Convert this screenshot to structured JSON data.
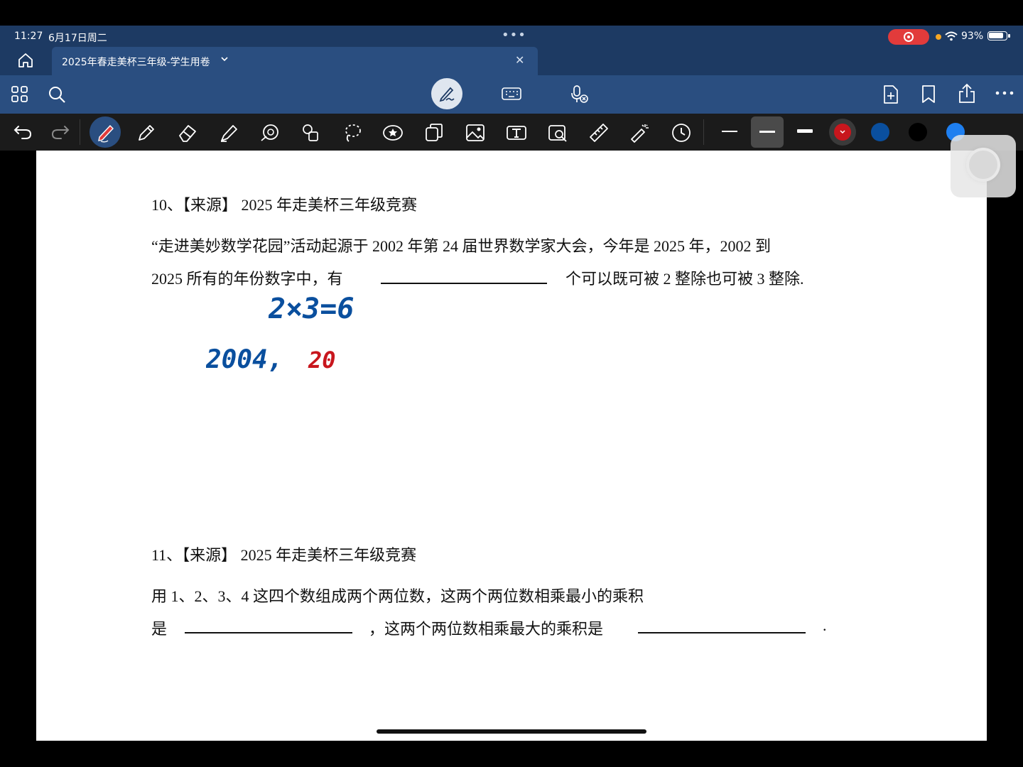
{
  "status": {
    "time": "11:27",
    "date": "6月17日周二",
    "battery": "93%",
    "battery_level": 0.93
  },
  "tab": {
    "title": "2025年春走美杯三年级-学生用卷"
  },
  "toolbar": {
    "top_icons": [
      "grid-icon",
      "search-icon",
      "handwriting-icon",
      "keyboard-icon",
      "voice-icon",
      "add-page-icon",
      "bookmark-icon",
      "share-icon",
      "more-icon"
    ],
    "tools": [
      "undo-icon",
      "redo-icon",
      "pen-icon",
      "pencil-icon",
      "eraser-icon",
      "highlighter-icon",
      "shape-icon",
      "element-icon",
      "lasso-icon",
      "sticker-icon",
      "copy-icon",
      "image-icon",
      "text-box-icon",
      "camera-icon",
      "ruler-icon",
      "laser-pointer-icon",
      "history-icon"
    ],
    "colors": [
      "#c8161d",
      "#0a4f9e",
      "#000000",
      "#1e7ff0"
    ]
  },
  "document": {
    "q10": {
      "header": "10、【来源】 2025 年走美杯三年级竞赛",
      "line1": "“走进美妙数学花园”活动起源于 2002 年第 24 届世界数学家大会，今年是 2025 年，2002 到",
      "line2a": "2025 所有的年份数字中，有",
      "line2b": "个可以既可被 2 整除也可被 3 整除."
    },
    "q11": {
      "header": "11、【来源】 2025 年走美杯三年级竞赛",
      "line1": "用 1、2、3、4 这四个数组成两个两位数，这两个两位数相乘最小的乘积",
      "line2a": "是",
      "line2b": "，这两个两位数相乘最大的乘积是",
      "line2c": "."
    },
    "handwriting": {
      "line1": "2×3=6",
      "line2a": "2004,",
      "line2b": "20"
    }
  }
}
